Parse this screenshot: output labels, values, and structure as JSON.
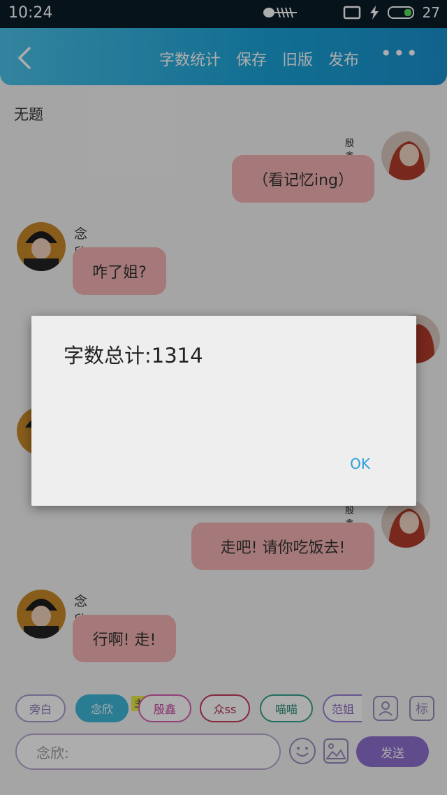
{
  "status_bar": {
    "time": "10:24",
    "battery": "27"
  },
  "header": {
    "menu": [
      "字数统计",
      "保存",
      "旧版",
      "发布"
    ],
    "more": "•••"
  },
  "doc_title": "无题",
  "messages": [
    {
      "side": "right",
      "name": "殷鑫",
      "text": "（看记忆ing）"
    },
    {
      "side": "left",
      "name": "念欣",
      "text": "咋了姐?"
    },
    {
      "side": "right",
      "name": "殷鑫",
      "text": "走吧! 请你吃饭去!"
    },
    {
      "side": "left",
      "name": "念欣",
      "text": "行啊! 走!"
    }
  ],
  "chips": [
    {
      "label": "旁白",
      "color": "#a99bcf"
    },
    {
      "label": "念欣",
      "color": "#3fb7d8"
    },
    {
      "label": "殷鑫",
      "color": "#d95fb3"
    },
    {
      "label": "众ss",
      "color": "#c23b5c"
    },
    {
      "label": "喵喵",
      "color": "#33a38c"
    },
    {
      "label": "范姐",
      "color": "#9a7fd6"
    }
  ],
  "host_badge": "主",
  "biao_label": "标",
  "input": {
    "placeholder": "念欣:"
  },
  "send_label": "发送",
  "dialog": {
    "message": "字数总计:1314",
    "ok_label": "OK"
  }
}
